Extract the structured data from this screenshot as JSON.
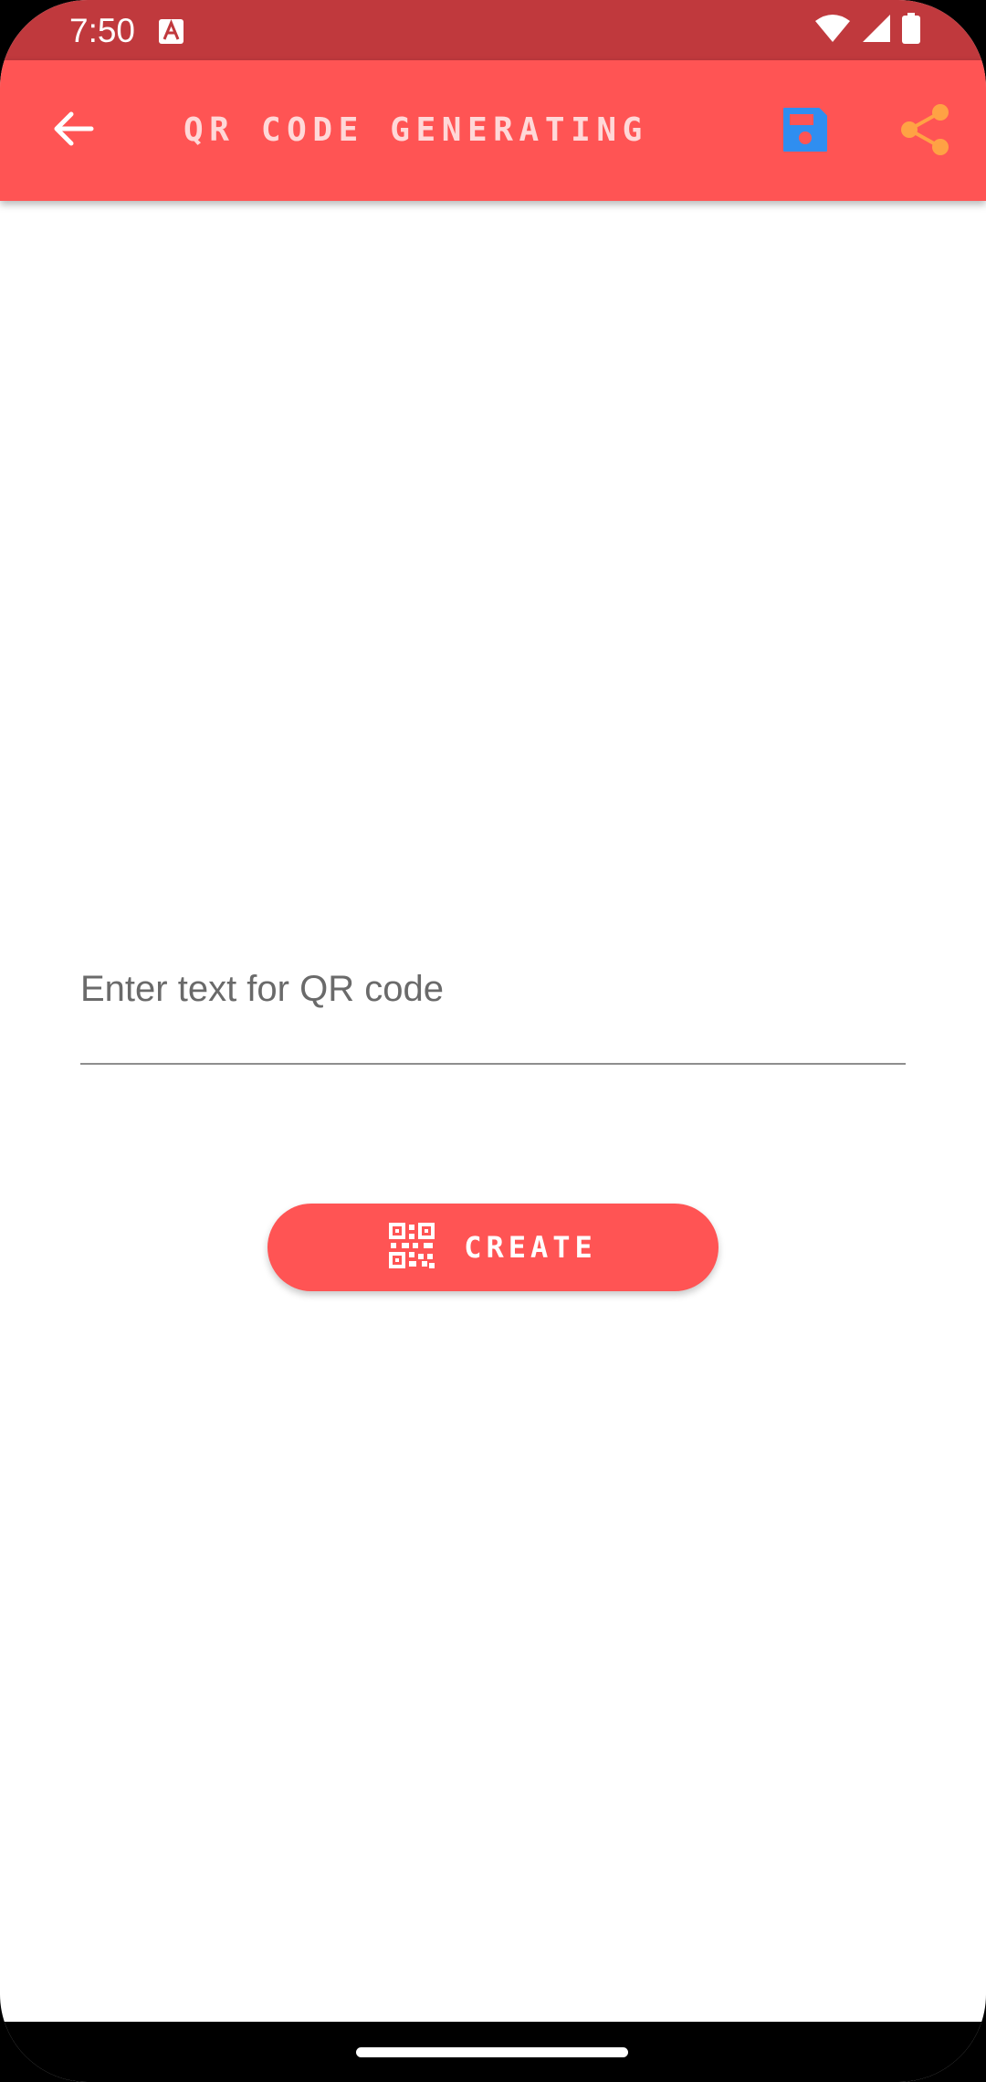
{
  "status_bar": {
    "time": "7:50",
    "notification_icon": "text-a-icon",
    "icons": [
      "wifi-icon",
      "signal-icon",
      "battery-icon"
    ],
    "background": "#c0393d"
  },
  "app_bar": {
    "title": "QR CODE GENERATING",
    "back_icon": "arrow-back-icon",
    "save_icon": "floppy-disk-icon",
    "share_icon": "share-icon",
    "background": "#ff5454",
    "save_color": "#2f8ef0",
    "share_color": "#ffa244"
  },
  "form": {
    "input_value": "",
    "input_placeholder": "Enter text for QR code"
  },
  "create_button": {
    "label": "CREATE",
    "icon": "qr-code-icon",
    "background": "#ff5454"
  },
  "navigation": {
    "handle": "gesture-handle"
  }
}
